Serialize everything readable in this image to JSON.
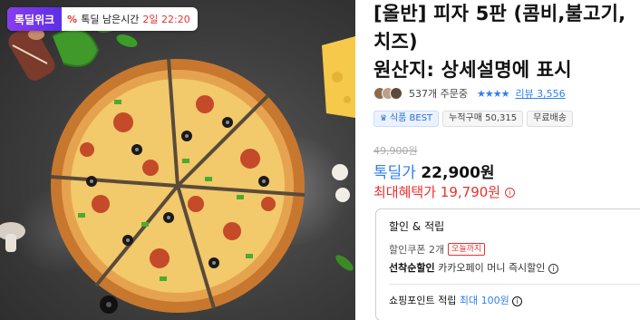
{
  "badge": {
    "brand": "톡딜위크",
    "percent_icon": "%",
    "label": "톡딜 남은시간",
    "remaining": "2일 22:20"
  },
  "product": {
    "title_line1": "[올반] 피자 5판 (콤비,불고기,",
    "title_line2": "치즈)",
    "title_line3": "원산지: 상세설명에 표시"
  },
  "stats": {
    "orders": "537개 주문중",
    "stars": "★★★★",
    "rating_fraction": 0.9,
    "review": "리뷰 3,556"
  },
  "tags": [
    "식품 BEST",
    "누적구매 50,315",
    "무료배송"
  ],
  "pricing": {
    "original": "49,900원",
    "deal_label": "톡딜가",
    "deal_price": "22,900원",
    "max_label": "최대혜택가",
    "max_price": "19,790원"
  },
  "benefits": {
    "title": "할인 & 적립",
    "coupon_label": "할인쿠폰 2개",
    "coupon_tag": "오늘까지",
    "first_label": "선착순할인",
    "first_detail": "카카오페이 머니 즉시할인",
    "point_label": "쇼핑포인트 적립",
    "point_max": "최대 100원"
  },
  "colors": {
    "accent_blue": "#2f80ed",
    "sale_red": "#e8322f",
    "brand_purple": "#6a35ea"
  }
}
